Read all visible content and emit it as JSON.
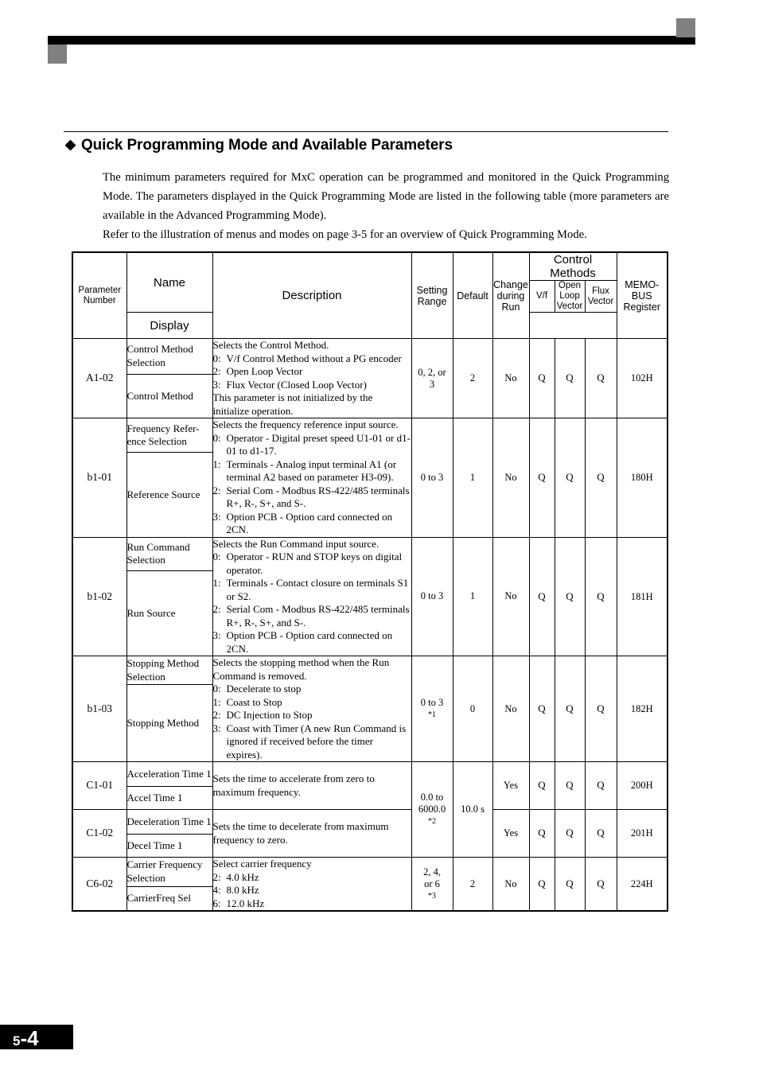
{
  "page": {
    "number": "5-4",
    "number_prefix": "5",
    "number_sep": "-",
    "number_suffix": "4"
  },
  "section": {
    "bullet": "◆",
    "heading": "Quick Programming Mode and Available Parameters",
    "paragraphs": [
      "The minimum parameters required for MxC operation can be programmed and monitored in the Quick Programming Mode. The parameters displayed in the Quick Programming Mode are listed in the following table (more parameters are available in the Advanced Programming Mode).",
      "Refer to the illustration of menus and modes on page 3-5 for an overview of Quick Programming Mode."
    ]
  },
  "table": {
    "headers": {
      "parameter_number": "Parameter Number",
      "parameter_number_l1": "Parameter",
      "parameter_number_l2": "Number",
      "name": "Name",
      "display": "Display",
      "description": "Description",
      "setting_range_l1": "Setting",
      "setting_range_l2": "Range",
      "default": "Default",
      "change_during_run_l1": "Change",
      "change_during_run_l2": "during",
      "change_during_run_l3": "Run",
      "control_methods_l1": "Control",
      "control_methods_l2": "Methods",
      "vf": "V/f",
      "open_loop_vector_l1": "Open",
      "open_loop_vector_l2": "Loop",
      "open_loop_vector_l3": "Vector",
      "flux_vector_l1": "Flux",
      "flux_vector_l2": "Vector",
      "memobus_l1": "MEMO-",
      "memobus_l2": "BUS",
      "memobus_l3": "Register"
    },
    "rows": [
      {
        "param": "A1-02",
        "name": "Control Method Selection",
        "display": "Control Method",
        "desc_intro": "Selects the Control Method.",
        "desc_items": [
          {
            "key": "0:",
            "val": "V/f Control Method without a PG encoder"
          },
          {
            "key": "2:",
            "val": "Open Loop Vector"
          },
          {
            "key": "3:",
            "val": "Flux Vector (Closed Loop Vector)"
          }
        ],
        "desc_outro": "This parameter is not initialized by the initialize operation.",
        "setting_range_l1": "0, 2, or",
        "setting_range_l2": "3",
        "setting_range_note": "",
        "default": "2",
        "change_during_run": "No",
        "vf": "Q",
        "olv": "Q",
        "flux": "Q",
        "register": "102H"
      },
      {
        "param": "b1-01",
        "name": "Frequency Refer-ence Selection",
        "name_l1": "Frequency Refer-",
        "name_l2": "ence Selection",
        "display": "Reference Source",
        "desc_intro": "Selects the frequency reference input source.",
        "desc_items": [
          {
            "key": "0:",
            "val": "Operator - Digital preset speed U1-01 or d1-01 to d1-17."
          },
          {
            "key": "1:",
            "val": "Terminals - Analog input terminal A1 (or terminal A2 based on parameter H3-09)."
          },
          {
            "key": "2:",
            "val": "Serial Com - Modbus RS-422/485 terminals R+, R-, S+, and S-."
          },
          {
            "key": "3:",
            "val": "Option PCB - Option card connected on 2CN."
          }
        ],
        "desc_outro": "",
        "setting_range_l1": "0 to 3",
        "setting_range_l2": "",
        "setting_range_note": "",
        "default": "1",
        "change_during_run": "No",
        "vf": "Q",
        "olv": "Q",
        "flux": "Q",
        "register": "180H"
      },
      {
        "param": "b1-02",
        "name": "Run Command Selection",
        "display": "Run Source",
        "desc_intro": "Selects the Run Command input source.",
        "desc_items": [
          {
            "key": "0:",
            "val": "Operator - RUN and STOP keys on digital operator."
          },
          {
            "key": "1:",
            "val": "Terminals - Contact closure on terminals S1 or S2."
          },
          {
            "key": "2:",
            "val": "Serial Com - Modbus RS-422/485 terminals R+, R-, S+, and S-."
          },
          {
            "key": "3:",
            "val": "Option PCB - Option card connected on 2CN."
          }
        ],
        "desc_outro": "",
        "setting_range_l1": "0 to 3",
        "setting_range_l2": "",
        "setting_range_note": "",
        "default": "1",
        "change_during_run": "No",
        "vf": "Q",
        "olv": "Q",
        "flux": "Q",
        "register": "181H"
      },
      {
        "param": "b1-03",
        "name": "Stopping Method Selection",
        "display": "Stopping Method",
        "desc_intro": "Selects the stopping method when the Run Command is removed.",
        "desc_items": [
          {
            "key": "0:",
            "val": "Decelerate to stop"
          },
          {
            "key": "1:",
            "val": "Coast to Stop"
          },
          {
            "key": "2:",
            "val": "DC Injection to Stop"
          },
          {
            "key": "3:",
            "val": "Coast with Timer (A new Run Command is ignored if received before the timer expires)."
          }
        ],
        "desc_outro": "",
        "setting_range_l1": "0 to 3",
        "setting_range_l2": "",
        "setting_range_note": "*1",
        "default": "0",
        "change_during_run": "No",
        "vf": "Q",
        "olv": "Q",
        "flux": "Q",
        "register": "182H"
      },
      {
        "param": "C1-01",
        "name": "Acceleration Time 1",
        "display": "Accel Time 1",
        "desc_intro": "Sets the time to accelerate from zero to maximum frequency.",
        "desc_items": [],
        "desc_outro": "",
        "change_during_run": "Yes",
        "vf": "Q",
        "olv": "Q",
        "flux": "Q",
        "register": "200H"
      },
      {
        "param": "C1-02",
        "name": "Deceleration Time 1",
        "display": "Decel Time 1",
        "desc_intro": "Sets the time to decelerate from maximum frequency to zero.",
        "desc_items": [],
        "desc_outro": "",
        "change_during_run": "Yes",
        "vf": "Q",
        "olv": "Q",
        "flux": "Q",
        "register": "201H"
      },
      {
        "param": "C6-02",
        "name": "Carrier Frequency Selection",
        "display": "CarrierFreq Sel",
        "desc_intro": "Select carrier frequency",
        "desc_items": [
          {
            "key": "2:",
            "val": "4.0 kHz"
          },
          {
            "key": "4:",
            "val": "8.0 kHz"
          },
          {
            "key": "6:",
            "val": "12.0 kHz"
          }
        ],
        "desc_outro": "",
        "setting_range_l1": "2, 4,",
        "setting_range_l2": "or 6",
        "setting_range_note": "*3",
        "default": "2",
        "change_during_run": "No",
        "vf": "Q",
        "olv": "Q",
        "flux": "Q",
        "register": "224H"
      }
    ],
    "c1_shared": {
      "setting_range_l1": "0.0 to",
      "setting_range_l2": "6000.0",
      "setting_range_note": "*2",
      "default": "10.0 s"
    }
  }
}
